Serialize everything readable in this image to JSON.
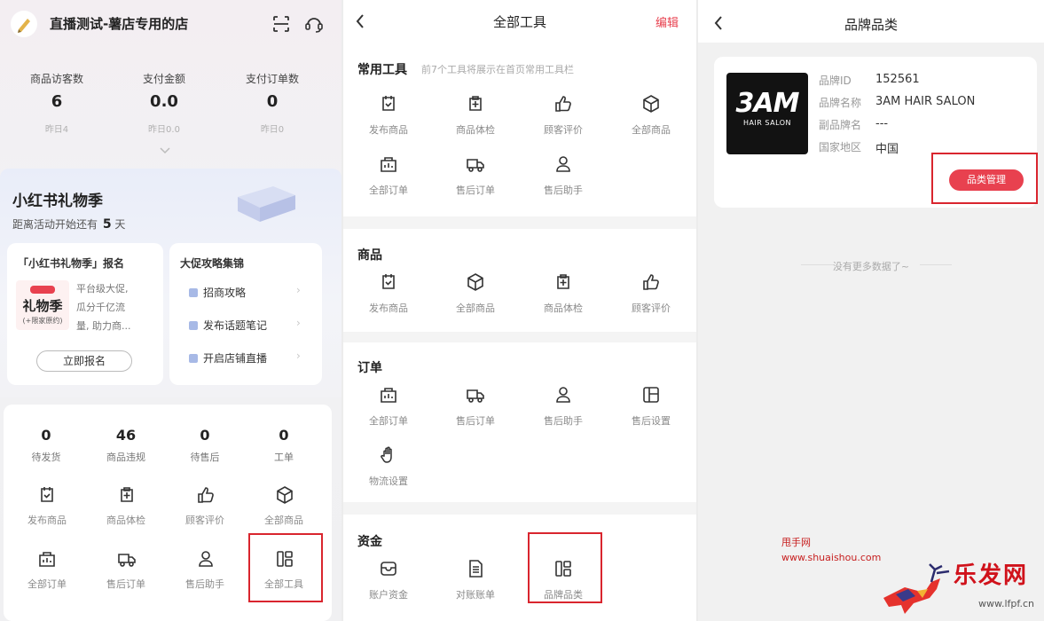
{
  "panel1": {
    "shop_title": "直播测试-薯店专用的店",
    "stats": [
      {
        "label": "商品访客数",
        "value": "6",
        "sub": "昨日4"
      },
      {
        "label": "支付金额",
        "value": "0.0",
        "sub": "昨日0.0"
      },
      {
        "label": "支付订单数",
        "value": "0",
        "sub": "昨日0"
      }
    ],
    "promo_title": "小红书礼物季",
    "promo_sub_prefix": "距离活动开始还有",
    "promo_days": "5",
    "promo_sub_suffix": "天",
    "signup_card": {
      "title": "「小红书礼物季」报名",
      "thumb_line1": "礼物季",
      "thumb_line2": "(+限家原约)",
      "desc": [
        "平台级大促,",
        "瓜分千亿流",
        "量, 助力商..."
      ],
      "button": "立即报名"
    },
    "guide_card": {
      "title": "大促攻略集锦",
      "links": [
        "招商攻略",
        "发布话题笔记",
        "开启店铺直播"
      ]
    },
    "counters": [
      {
        "value": "0",
        "label": "待发货"
      },
      {
        "value": "46",
        "label": "商品违规"
      },
      {
        "value": "0",
        "label": "待售后"
      },
      {
        "value": "0",
        "label": "工单"
      }
    ],
    "tools_row1": [
      "发布商品",
      "商品体检",
      "顾客评价",
      "全部商品"
    ],
    "tools_row2": [
      "全部订单",
      "售后订单",
      "售后助手",
      "全部工具"
    ]
  },
  "panel2": {
    "title": "全部工具",
    "edit": "编辑",
    "common": {
      "title": "常用工具",
      "hint": "前7个工具将展示在首页常用工具栏",
      "row1": [
        "发布商品",
        "商品体检",
        "顾客评价",
        "全部商品"
      ],
      "row2": [
        "全部订单",
        "售后订单",
        "售后助手"
      ]
    },
    "goods": {
      "title": "商品",
      "items": [
        "发布商品",
        "全部商品",
        "商品体检",
        "顾客评价"
      ]
    },
    "orders": {
      "title": "订单",
      "row1": [
        "全部订单",
        "售后订单",
        "售后助手",
        "售后设置"
      ],
      "row2": [
        "物流设置"
      ]
    },
    "funds": {
      "title": "资金",
      "items": [
        "账户资金",
        "对账账单",
        "品牌品类"
      ]
    }
  },
  "panel3": {
    "title": "品牌品类",
    "logo_big": "3AM",
    "logo_small": "HAIR SALON",
    "fields": [
      {
        "key": "品牌ID",
        "value": "152561"
      },
      {
        "key": "品牌名称",
        "value": "3AM HAIR SALON"
      },
      {
        "key": "副品牌名",
        "value": "---"
      },
      {
        "key": "国家地区",
        "value": "中国"
      }
    ],
    "manage_button": "品类管理",
    "empty_text": "没有更多数据了~"
  },
  "watermark": {
    "line1": "甩手网",
    "line2": "www.shuaishou.com",
    "brand": "乐发网",
    "url": "www.lfpf.cn"
  },
  "colors": {
    "accent": "#e8414f",
    "highlight_box": "#d9252e"
  }
}
